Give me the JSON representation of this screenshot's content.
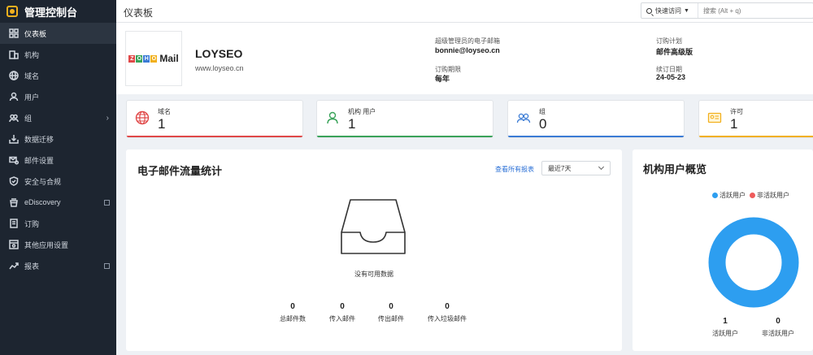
{
  "app": {
    "title": "管理控制台"
  },
  "sidebar": {
    "items": [
      {
        "label": "仪表板",
        "icon": "dashboard-icon",
        "active": true
      },
      {
        "label": "机构",
        "icon": "organization-icon"
      },
      {
        "label": "域名",
        "icon": "globe-icon"
      },
      {
        "label": "用户",
        "icon": "user-icon"
      },
      {
        "label": "组",
        "icon": "group-icon",
        "chevron": true
      },
      {
        "label": "数据迁移",
        "icon": "migration-icon"
      },
      {
        "label": "邮件设置",
        "icon": "mail-settings-icon"
      },
      {
        "label": "安全与合规",
        "icon": "shield-icon"
      },
      {
        "label": "eDiscovery",
        "icon": "ediscovery-icon",
        "external": true
      },
      {
        "label": "订购",
        "icon": "subscription-icon"
      },
      {
        "label": "其他应用设置",
        "icon": "apps-settings-icon"
      },
      {
        "label": "报表",
        "icon": "reports-icon",
        "external": true
      }
    ]
  },
  "topbar": {
    "title": "仪表板",
    "quick_access": "快速访问",
    "search_placeholder": "搜索 (Alt + q)"
  },
  "org": {
    "logo_text": "ZOHO",
    "logo_suffix": "Mail",
    "name": "LOYSEO",
    "website": "www.loyseo.cn",
    "admin_email_label": "超级管理员的电子邮箱",
    "admin_email": "bonnie@loyseo.cn",
    "plan_label": "订购计划",
    "plan": "邮件高级版",
    "term_label": "订购期限",
    "term": "每年",
    "renewal_label": "续订日期",
    "renewal": "24-05-23"
  },
  "stats": [
    {
      "label": "域名",
      "value": "1",
      "color": "#e04848",
      "icon": "globe-icon"
    },
    {
      "label": "机构 用户",
      "value": "1",
      "color": "#3aa35a",
      "icon": "user-icon"
    },
    {
      "label": "组",
      "value": "0",
      "color": "#3a7bd5",
      "icon": "group-icon"
    },
    {
      "label": "许可",
      "value": "1",
      "color": "#f2b01e",
      "icon": "license-icon"
    }
  ],
  "traffic": {
    "title": "电子邮件流量统计",
    "view_all": "查看所有报表",
    "range": "最近7天",
    "empty": "没有可用数据",
    "metrics": [
      {
        "value": "0",
        "label": "总邮件数"
      },
      {
        "value": "0",
        "label": "传入邮件"
      },
      {
        "value": "0",
        "label": "传出邮件"
      },
      {
        "value": "0",
        "label": "传入垃圾邮件"
      }
    ]
  },
  "users_overview": {
    "title": "机构用户概览",
    "legend_active": "活跃用户",
    "legend_inactive": "非活跃用户",
    "active_color": "#2d9ef0",
    "inactive_color": "#ef5b5b",
    "active_count": "1",
    "inactive_count": "0"
  },
  "chart_data": {
    "type": "pie",
    "categories": [
      "活跃用户",
      "非活跃用户"
    ],
    "values": [
      1,
      0
    ]
  }
}
